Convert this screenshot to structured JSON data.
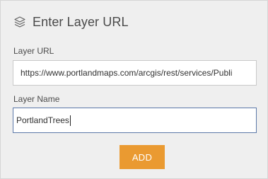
{
  "header": {
    "icon": "layers-icon",
    "title": "Enter Layer URL"
  },
  "form": {
    "url_label": "Layer URL",
    "url_value": "https://www.portlandmaps.com/arcgis/rest/services/Publi",
    "name_label": "Layer Name",
    "name_value": "PortlandTrees"
  },
  "actions": {
    "add_label": "ADD"
  },
  "colors": {
    "panel_background": "#efefef",
    "accent_button": "#ea9a31",
    "focused_border": "#5b78a8"
  }
}
